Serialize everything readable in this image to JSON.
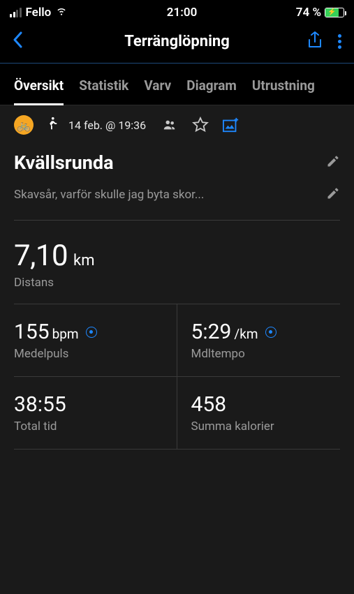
{
  "status": {
    "carrier": "Fello",
    "time": "21:00",
    "battery_pct": "74 %"
  },
  "nav": {
    "title": "Terränglöpning"
  },
  "tabs": [
    {
      "label": "Översikt",
      "active": true
    },
    {
      "label": "Statistik",
      "active": false
    },
    {
      "label": "Varv",
      "active": false
    },
    {
      "label": "Diagram",
      "active": false
    },
    {
      "label": "Utrustning",
      "active": false
    }
  ],
  "activity": {
    "datetime": "14 feb. @ 19:36",
    "title": "Kvällsrunda",
    "note": "Skavsår, varför skulle jag byta skor..."
  },
  "stats": {
    "distance": {
      "value": "7,10",
      "unit": "km",
      "label": "Distans"
    },
    "hr": {
      "value": "155",
      "unit": "bpm",
      "label": "Medelpuls"
    },
    "pace": {
      "value": "5:29",
      "unit": "/km",
      "label": "Mdltempo"
    },
    "time": {
      "value": "38:55",
      "label": "Total tid"
    },
    "calories": {
      "value": "458",
      "label": "Summa kalorier"
    }
  }
}
